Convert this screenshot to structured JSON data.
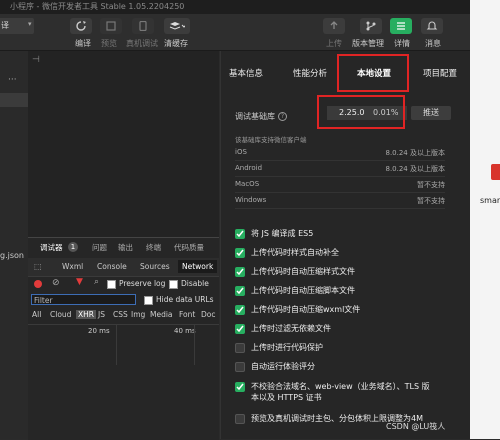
{
  "window": {
    "title": "小程序 - 微信开发者工具 Stable 1.05.2204250"
  },
  "toolbar": {
    "mode_select": "译",
    "left_labels": [
      "编译",
      "预览",
      "真机调试",
      "清缓存"
    ],
    "right_labels": [
      "上传",
      "版本管理",
      "详情",
      "消息"
    ]
  },
  "left": {
    "file_label": "g.json"
  },
  "devtools": {
    "tabs": [
      "调试器",
      "问题",
      "输出",
      "终端",
      "代码质量"
    ],
    "badge": "1",
    "panel_tabs": [
      "Wxml",
      "Console",
      "Sources",
      "Network"
    ],
    "preserve_log": "Preserve log",
    "disable": "Disable",
    "filter_placeholder": "Filter",
    "hide_data_urls": "Hide data URLs",
    "type_filters": [
      "All",
      "Cloud",
      "XHR",
      "JS",
      "CSS",
      "Img",
      "Media",
      "Font",
      "Doc"
    ],
    "timeline": [
      "20 ms",
      "40 ms"
    ]
  },
  "details": {
    "tabs": [
      "基本信息",
      "性能分析",
      "本地设置",
      "项目配置"
    ],
    "active_tab": "本地设置",
    "lib_label": "调试基础库",
    "lib_version": "2.25.0",
    "lib_percent": "0.01%",
    "push_button": "推送",
    "support_note": "该基础库支持微信客户端",
    "os_rows": [
      {
        "name": "iOS",
        "ver": "8.0.24 及以上版本"
      },
      {
        "name": "Android",
        "ver": "8.0.24 及以上版本"
      },
      {
        "name": "MacOS",
        "ver": "暂不支持"
      },
      {
        "name": "Windows",
        "ver": "暂不支持"
      }
    ],
    "options": [
      {
        "label": "将 JS 编译成 ES5",
        "checked": true
      },
      {
        "label": "上传代码时样式自动补全",
        "checked": true
      },
      {
        "label": "上传代码时自动压缩样式文件",
        "checked": true
      },
      {
        "label": "上传代码时自动压缩脚本文件",
        "checked": true
      },
      {
        "label": "上传代码时自动压缩wxml文件",
        "checked": true
      },
      {
        "label": "上传时过滤无依赖文件",
        "checked": true
      },
      {
        "label": "上传时进行代码保护",
        "checked": false
      },
      {
        "label": "自动运行体验评分",
        "checked": false
      },
      {
        "label": "不校验合法域名、web-view（业务域名）、TLS 版",
        "label2": "本以及 HTTPS 证书",
        "checked": true
      },
      {
        "label": "预览及真机调试时主包、分包体积上限调整为4M",
        "checked": false
      }
    ]
  },
  "desktop": {
    "icon_label": "smar"
  },
  "watermark": "CSDN @LU筏人",
  "colors": {
    "accent_green": "#27ae60",
    "highlight_red": "#e02424"
  }
}
